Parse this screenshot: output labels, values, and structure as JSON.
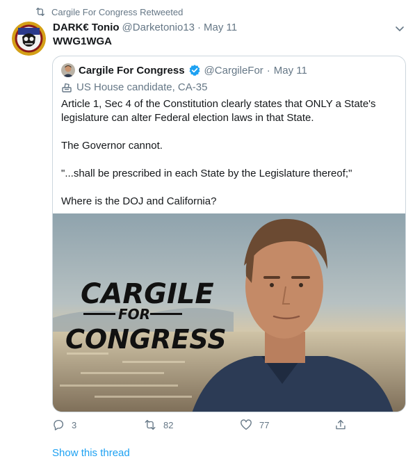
{
  "retweet_context": {
    "text": "Cargile For Congress Retweeted",
    "icon": "retweet-icon"
  },
  "tweet": {
    "author_name": "DARK€ Tonio",
    "author_handle": "@Darketonio13",
    "separator": "·",
    "date": "May 11",
    "text": "WWG1WGA"
  },
  "quoted_tweet": {
    "author_name": "Cargile For Congress",
    "author_handle": "@CargileFor",
    "separator": "·",
    "date": "May 11",
    "label": "US House candidate, CA-35",
    "paragraphs": [
      "Article 1, Sec 4 of the Constitution clearly states that ONLY a State's legislature can alter Federal election laws in that State.",
      "The Governor cannot.",
      "\"...shall be prescribed in each State by the Legislature thereof;\"",
      "Where is the DOJ and California?"
    ],
    "media_text": {
      "line1": "CARGILE",
      "line2": "FOR",
      "line3": "CONGRESS"
    }
  },
  "actions": {
    "replies": "3",
    "retweets": "82",
    "likes": "77"
  },
  "show_thread": "Show this thread",
  "colors": {
    "link": "#1da1f2",
    "secondary": "#657786",
    "border": "#ccd6dd",
    "verified": "#1da1f2"
  }
}
